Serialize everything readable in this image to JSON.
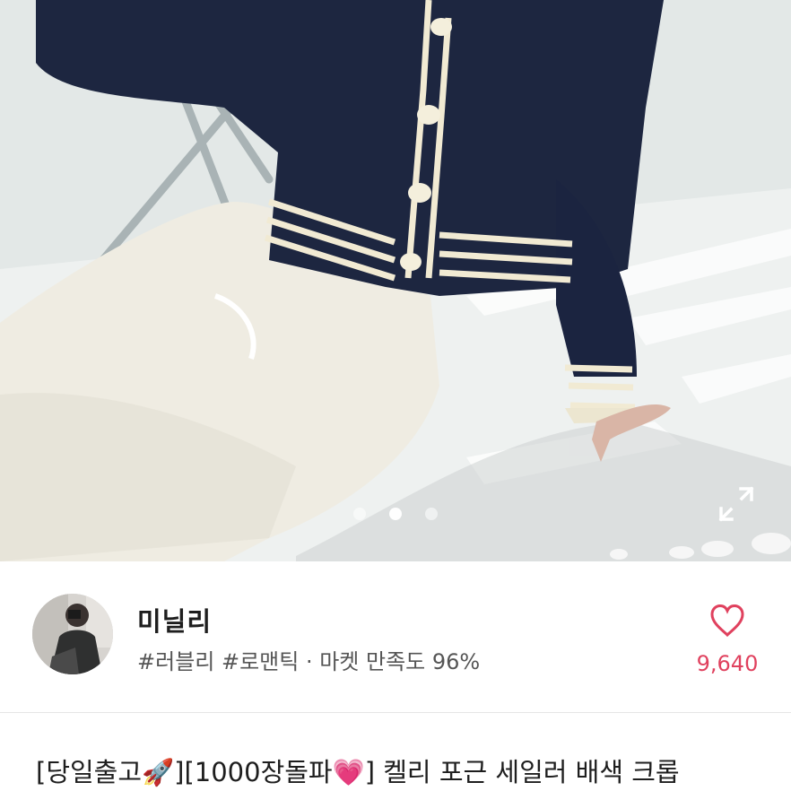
{
  "product_image": {
    "alt_icons": {
      "expand": "expand-arrows-icon"
    },
    "pager": {
      "count": 3,
      "active_index": 1
    }
  },
  "seller": {
    "name": "미닐리",
    "tags": "#러블리 #로맨틱 · 마켓 만족도 96%",
    "likes": "9,640",
    "like_icon": "heart-outline-icon",
    "like_color": "#e0415e"
  },
  "product": {
    "title": "[당일출고🚀][1000장돌파💗] 켈리 포근 세일러 배색 크롭"
  }
}
